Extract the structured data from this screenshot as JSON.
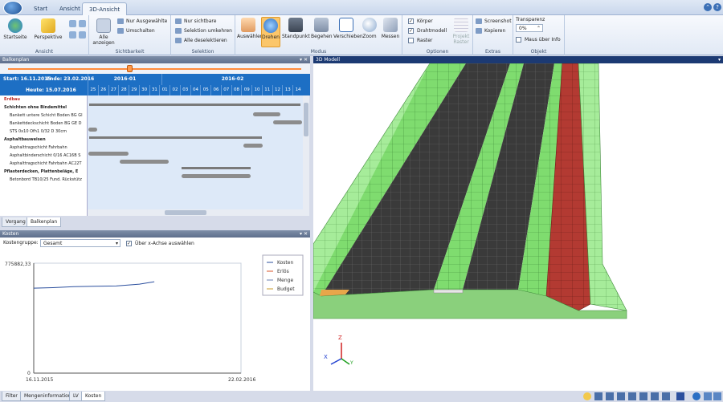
{
  "ribbon": {
    "tabs": [
      "Start",
      "Ansicht",
      "3D-Ansicht"
    ],
    "groups": {
      "ansicht": {
        "title": "Ansicht",
        "startseite": "Startseite",
        "perspektive": "Perspektive"
      },
      "sichtbarkeit": {
        "title": "Sichtbarkeit",
        "alle_anzeigen": "Alle anzeigen",
        "nur_ausgewaehlte": "Nur Ausgewählte",
        "umschalten": "Umschalten"
      },
      "selektion": {
        "title": "Selektion",
        "nur_sichtbare": "Nur sichtbare",
        "umkehren": "Selektion umkehren",
        "deselektieren": "Alle deselektieren"
      },
      "modus": {
        "title": "Modus",
        "items": [
          "Auswählen",
          "Drehen",
          "Standpunkt",
          "Begehen",
          "Verschieben",
          "Zoom",
          "Messen"
        ]
      },
      "optionen": {
        "title": "Optionen",
        "koerper": "Körper",
        "drahtmodell": "Drahtmodell",
        "raster": "Raster",
        "projekt_raster": "Projekt Raster"
      },
      "extras": {
        "title": "Extras",
        "screenshot": "Screenshot",
        "kopieren": "Kopieren"
      },
      "objekt": {
        "title": "Objekt",
        "transparenz": "Transparenz",
        "transparenz_value": "0%",
        "maus_ueber_info": "Maus über Info"
      }
    }
  },
  "balkenplan": {
    "title": "Balkenplan",
    "start": "Start: 16.11.2015",
    "ende": "Ende: 23.02.2016",
    "heute": "Heute: 15.07.2016",
    "months": [
      "2016-01",
      "2016-02"
    ],
    "days": [
      "25",
      "26",
      "27",
      "28",
      "29",
      "30",
      "31",
      "01",
      "02",
      "03",
      "04",
      "05",
      "06",
      "07",
      "08",
      "09",
      "10",
      "11",
      "12",
      "13",
      "14"
    ],
    "rows": [
      {
        "label": "Erdbau",
        "header": true,
        "red": true
      },
      {
        "label": "Schichten ohne Bindemittel",
        "header": true
      },
      {
        "label": "Bankett untere Schicht Boden BG GI",
        "header": false
      },
      {
        "label": "Bankettdeckschicht Boden BG GE D",
        "header": false
      },
      {
        "label": "STS 0x10 Ofh1 0/32 D 30cm",
        "header": false
      },
      {
        "label": "Asphaltbauweisen",
        "header": true
      },
      {
        "label": "Asphalttragschicht Fahrbahn",
        "header": false
      },
      {
        "label": "Asphaltbinderschicht 0/16 AC16B S",
        "header": false
      },
      {
        "label": "Asphalttragschicht Fahrbahn AC22T",
        "header": false
      },
      {
        "label": "Pflasterdecken, Plattenbeläge, E",
        "header": true
      },
      {
        "label": "Betonbord TB10/25 Fund. Rückstütz",
        "header": false
      }
    ],
    "bottom_tabs": [
      "Vorgang",
      "Balkenplan"
    ]
  },
  "kosten": {
    "title": "Kosten",
    "kostengruppe_label": "Kostengruppe:",
    "kostengruppe_value": "Gesamt",
    "ueber_x_achse": "Über x-Achse auswählen"
  },
  "chart_data": {
    "type": "line",
    "ylim": [
      0,
      775882.33
    ],
    "y_tick_top": "775882,33",
    "y_tick_bottom": "0",
    "x_start_label": "16.11.2015",
    "x_end_label": "22.02.2016",
    "series": [
      {
        "name": "Kosten",
        "color": "#2b4f9e",
        "x": [
          "16.11.2015",
          "25.11.2015",
          "05.12.2015",
          "15.12.2015",
          "25.12.2015",
          "05.01.2016",
          "12.01.2016"
        ],
        "values": [
          600000,
          603000,
          610000,
          613000,
          615000,
          628000,
          645000
        ]
      },
      {
        "name": "Erlös",
        "color": "#d9552b",
        "x": [],
        "values": []
      },
      {
        "name": "Menge",
        "color": "#6a7fb0",
        "x": [],
        "values": []
      },
      {
        "name": "Budget",
        "color": "#c89b2b",
        "x": [],
        "values": []
      }
    ]
  },
  "bottom_left_tabs": [
    "Filter",
    "Mengeninformation",
    "LV",
    "Kosten"
  ],
  "view3d": {
    "title": "3D Modell",
    "axis_z": "Z",
    "axis_x": "X",
    "axis_y": "Y"
  },
  "colors": {
    "ribbon_accent": "#1d6fc4",
    "road_asphalt": "#3a3a3a",
    "road_green": "#7fdc6f",
    "road_red": "#b33a32",
    "active_tool": "#fbc66a"
  }
}
